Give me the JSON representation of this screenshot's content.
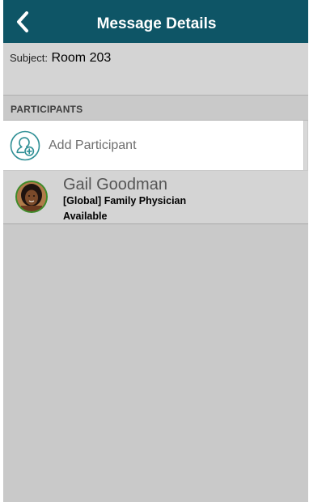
{
  "header": {
    "title": "Message Details",
    "background": "#0e5566"
  },
  "subject": {
    "label": "Subject:",
    "value": "Room 203"
  },
  "participants": {
    "section_title": "PARTICIPANTS",
    "add_label": "Add Participant",
    "accent": "#2f8f95",
    "items": [
      {
        "name": "Gail Goodman",
        "role": "[Global] Family Physician",
        "status": "Available",
        "status_ring_color": "#3d8b2a",
        "avatar": "person-avatar"
      }
    ]
  }
}
